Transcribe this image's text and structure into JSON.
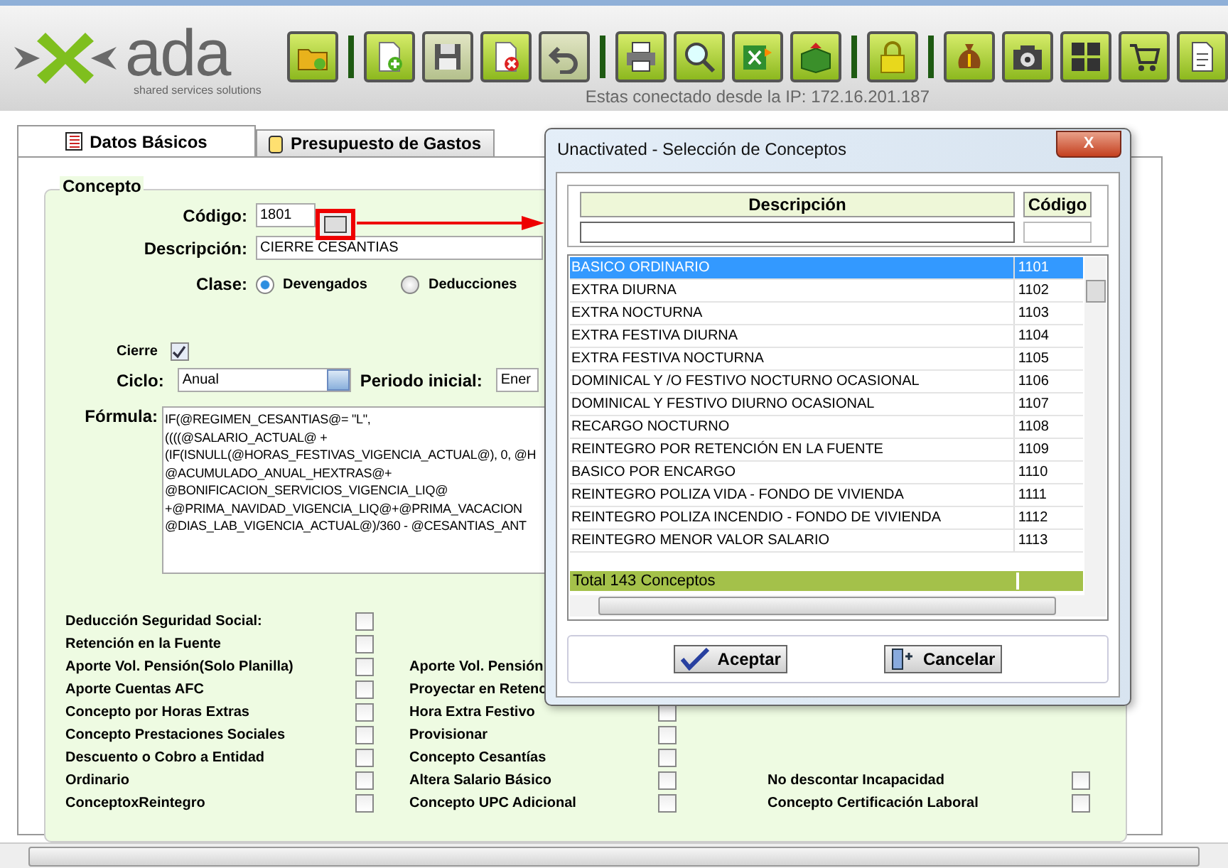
{
  "logo": {
    "name": "ada",
    "tagline": "shared services solutions"
  },
  "toolbar": [
    {
      "kind": "open",
      "disabled": false,
      "separator_after": true
    },
    {
      "kind": "new",
      "disabled": false,
      "separator_after": false
    },
    {
      "kind": "save",
      "disabled": true,
      "separator_after": false
    },
    {
      "kind": "delete",
      "disabled": false,
      "separator_after": false
    },
    {
      "kind": "undo",
      "disabled": true,
      "separator_after": true
    },
    {
      "kind": "print",
      "disabled": false,
      "separator_after": false
    },
    {
      "kind": "search",
      "disabled": false,
      "separator_after": false
    },
    {
      "kind": "export",
      "disabled": false,
      "separator_after": false
    },
    {
      "kind": "box",
      "disabled": false,
      "separator_after": true
    },
    {
      "kind": "lock",
      "disabled": false,
      "separator_after": true
    },
    {
      "kind": "money",
      "disabled": false,
      "separator_after": false
    },
    {
      "kind": "camera",
      "disabled": false,
      "separator_after": false
    },
    {
      "kind": "grid",
      "disabled": false,
      "separator_after": false
    },
    {
      "kind": "cart",
      "disabled": false,
      "separator_after": false
    },
    {
      "kind": "document",
      "disabled": false,
      "separator_after": false
    }
  ],
  "connection": "Estas conectado desde la IP: 172.16.201.187",
  "tabs": [
    {
      "label": "Datos Básicos",
      "selected": true,
      "kind": "list"
    },
    {
      "label": "Presupuesto de Gastos",
      "selected": false,
      "kind": "cylinder"
    }
  ],
  "concepto": {
    "legend": "Concepto",
    "codigo_label": "Código:",
    "codigo": "1801",
    "descripcion_label": "Descripción:",
    "descripcion": "CIERRE CESANTIAS",
    "clase_label": "Clase:",
    "clase_options": [
      {
        "label": "Devengados",
        "selected": true
      },
      {
        "label": "Deducciones",
        "selected": false
      }
    ],
    "cierre_label": "Cierre",
    "cierre_checked": true,
    "ciclo_label": "Ciclo:",
    "ciclo": "Anual",
    "periodo_label": "Periodo inicial:",
    "periodo": "Ener",
    "formula_label": "Fórmula:",
    "formula_lines": [
      "IF(@REGIMEN_CESANTIAS@= \"L\",",
      "((((@SALARIO_ACTUAL@ +",
      "(IF(ISNULL(@HORAS_FESTIVAS_VIGENCIA_ACTUAL@), 0, @H",
      "@ACUMULADO_ANUAL_HEXTRAS@+",
      " @BONIFICACION_SERVICIOS_VIGENCIA_LIQ@",
      "+@PRIMA_NAVIDAD_VIGENCIA_LIQ@+@PRIMA_VACACION",
      " @DIAS_LAB_VIGENCIA_ACTUAL@)/360 - @CESANTIAS_ANT"
    ]
  },
  "flags": {
    "column_1": [
      {
        "label": "Deducción Seguridad Social:",
        "checked": false
      },
      {
        "label": "Retención en la Fuente",
        "checked": false
      },
      {
        "label": "Aporte Vol. Pensión(Solo Planilla)",
        "checked": false
      },
      {
        "label": "Aporte Cuentas AFC",
        "checked": false
      },
      {
        "label": "Concepto por Horas Extras",
        "checked": false
      },
      {
        "label": "Concepto Prestaciones Sociales",
        "checked": false
      },
      {
        "label": "Descuento o Cobro a Entidad",
        "checked": false
      },
      {
        "label": "Ordinario",
        "checked": false
      },
      {
        "label": "ConceptoxReintegro",
        "checked": false
      }
    ],
    "column_2": [
      {
        "label": "Aporte Vol. Pensión"
      },
      {
        "label": "Proyectar en Retenc"
      },
      {
        "label": "Hora Extra Festivo",
        "checked": false
      },
      {
        "label": "Provisionar",
        "checked": false
      },
      {
        "label": "Concepto Cesantías",
        "checked": false
      },
      {
        "label": "Altera Salario Básico",
        "checked": false
      },
      {
        "label": "Concepto UPC Adicional",
        "checked": false
      }
    ],
    "column_3": [
      {
        "label": "No descontar Incapacidad",
        "checked": false
      },
      {
        "label": "Concepto Certificación Laboral",
        "checked": false
      }
    ]
  },
  "dialog": {
    "title": "Unactivated - Selección de Conceptos",
    "close": "X",
    "columns": [
      "Descripción",
      "Código"
    ],
    "rows": [
      {
        "descripcion": "BASICO ORDINARIO",
        "codigo": "1101",
        "selected": true
      },
      {
        "descripcion": "EXTRA DIURNA",
        "codigo": "1102",
        "selected": false
      },
      {
        "descripcion": "EXTRA NOCTURNA",
        "codigo": "1103",
        "selected": false
      },
      {
        "descripcion": "EXTRA FESTIVA DIURNA",
        "codigo": "1104",
        "selected": false
      },
      {
        "descripcion": "EXTRA FESTIVA NOCTURNA",
        "codigo": "1105",
        "selected": false
      },
      {
        "descripcion": "DOMINICAL Y /O FESTIVO NOCTURNO OCASIONAL",
        "codigo": "1106",
        "selected": false
      },
      {
        "descripcion": "DOMINICAL Y FESTIVO DIURNO OCASIONAL",
        "codigo": "1107",
        "selected": false
      },
      {
        "descripcion": "RECARGO NOCTURNO",
        "codigo": "1108",
        "selected": false
      },
      {
        "descripcion": "REINTEGRO POR RETENCIÓN EN LA FUENTE",
        "codigo": "1109",
        "selected": false
      },
      {
        "descripcion": "BASICO POR ENCARGO",
        "codigo": "1110",
        "selected": false
      },
      {
        "descripcion": "REINTEGRO POLIZA VIDA - FONDO DE VIVIENDA",
        "codigo": "1111",
        "selected": false
      },
      {
        "descripcion": "REINTEGRO POLIZA INCENDIO - FONDO DE VIVIENDA",
        "codigo": "1112",
        "selected": false
      },
      {
        "descripcion": "REINTEGRO MENOR VALOR SALARIO",
        "codigo": "1113",
        "selected": false
      }
    ],
    "total": "Total 143 Conceptos",
    "accept": "Aceptar",
    "cancel": "Cancelar"
  }
}
